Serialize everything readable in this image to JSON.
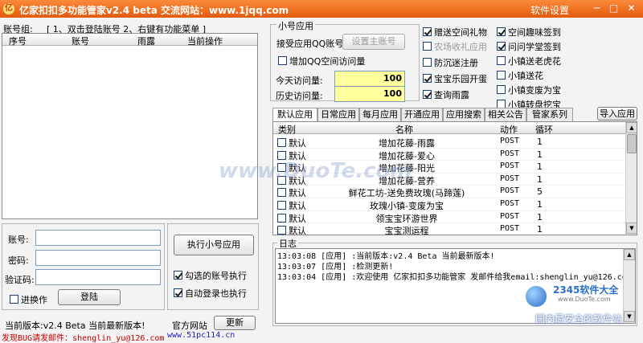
{
  "window": {
    "title": "亿家扣扣多功能管家v2.4 beta 交流网站：www.1jqq.com",
    "settings": "软件设置",
    "min": "─",
    "max": "□",
    "close": "✕",
    "app_icon": "亿"
  },
  "accounts": {
    "group_label": "账号组:",
    "hint": "[ 1、双击登陆账号 2、右键有功能菜单 ]",
    "columns": [
      "序号",
      "账号",
      "雨露",
      "当前操作"
    ]
  },
  "login": {
    "account_label": "账号:",
    "password_label": "密码:",
    "captcha_label": "验证码:",
    "stealth_label": "进换作",
    "login_button": "登陆",
    "run_small_button": "执行小号应用",
    "checked_exec_label": "勾选的账号执行",
    "auto_login_label": "自动登录也执行",
    "official_site": "官方网站",
    "update_button": "更新"
  },
  "status": {
    "version_text": "当前版本:v2.4 Beta 当前最新版本!",
    "bug_text": "发现BUG请发邮件：shenglin_yu@126.com",
    "site_text": "www.51pc114.cn"
  },
  "small_app": {
    "group_title": "小号应用",
    "accept_label": "接受应用QQ账号:",
    "set_main_button": "设置主账号",
    "add_visits_label": "增加QQ空间访问量",
    "today_label": "今天访问量:",
    "today_value": "100",
    "history_label": "历史访问量:",
    "history_value": "100"
  },
  "options": [
    {
      "label": "赠送空间礼物",
      "checked": true,
      "enabled": true
    },
    {
      "label": "空间趣味签到",
      "checked": true,
      "enabled": true
    },
    {
      "label": "农场收礼应用",
      "checked": false,
      "enabled": false
    },
    {
      "label": "问问学堂签到",
      "checked": true,
      "enabled": true
    },
    {
      "label": "防沉迷注册",
      "checked": false,
      "enabled": true
    },
    {
      "label": "小镇送老虎花",
      "checked": false,
      "enabled": true
    },
    {
      "label": "宝宝乐园开蛋",
      "checked": true,
      "enabled": true
    },
    {
      "label": "小镇送花",
      "checked": false,
      "enabled": true
    },
    {
      "label": "查询雨露",
      "checked": true,
      "enabled": true
    },
    {
      "label": "小镇变废为宝",
      "checked": false,
      "enabled": true
    },
    {
      "label": "小镇转盘挖宝",
      "checked": false,
      "enabled": true
    }
  ],
  "tabs": [
    "默认应用",
    "日常应用",
    "每月应用",
    "开通应用",
    "应用搜索",
    "相关公告",
    "管家系列"
  ],
  "import_button": "导入应用",
  "app_table": {
    "columns": [
      "类别",
      "名称",
      "动作",
      "循环"
    ],
    "rows": [
      {
        "cat": "默认",
        "name": "增加花藤-雨露",
        "action": "POST",
        "loop": "1"
      },
      {
        "cat": "默认",
        "name": "增加花藤-爱心",
        "action": "POST",
        "loop": "1"
      },
      {
        "cat": "默认",
        "name": "增加花藤-阳光",
        "action": "POST",
        "loop": "1"
      },
      {
        "cat": "默认",
        "name": "增加花藤-营养",
        "action": "POST",
        "loop": "1"
      },
      {
        "cat": "默认",
        "name": "鲜花工坊-送免费玫瑰(马蹄莲)",
        "action": "POST",
        "loop": "5"
      },
      {
        "cat": "默认",
        "name": "玫瑰小镇-变废为宝",
        "action": "POST",
        "loop": "1"
      },
      {
        "cat": "默认",
        "name": "领宝宝环游世界",
        "action": "POST",
        "loop": "1"
      },
      {
        "cat": "默认",
        "name": "宝宝测运程",
        "action": "POST",
        "loop": "1"
      }
    ]
  },
  "log": {
    "title": "日志",
    "lines": [
      "13:03:08 [应用] :当前版本:v2.4 Beta 当前最新版本!",
      "13:03:07 [应用] :检测更新!",
      "13:03:04 [应用] :欢迎使用 亿家扣扣多功能管家 发邮件给我email:shenglin_yu@126.com"
    ]
  },
  "watermarks": {
    "duote": "www.DuoTe.com",
    "brand": "2345软件大全",
    "brand_url": "www.DuoTe.com",
    "slogan": "国内最安全的软件站"
  }
}
